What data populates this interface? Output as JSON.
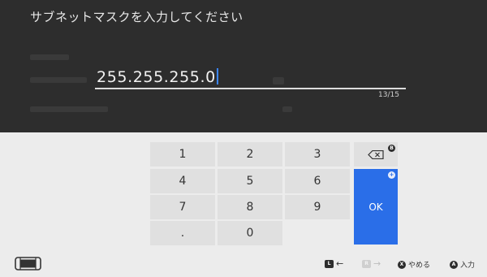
{
  "dialog": {
    "title": "サブネットマスクを入力してください"
  },
  "input": {
    "value": "255.255.255.0",
    "char_count": "13/15"
  },
  "keypad": {
    "keys": [
      "1",
      "2",
      "3",
      "4",
      "5",
      "6",
      "7",
      "8",
      "9",
      ".",
      "0"
    ],
    "backspace_badge": "B",
    "ok_label": "OK",
    "ok_badge": "+"
  },
  "footer": {
    "left_button": "L",
    "left_arrow": "←",
    "right_button": "R",
    "right_arrow": "→",
    "cancel_button": "X",
    "cancel_label": "やめる",
    "confirm_button": "A",
    "confirm_label": "入力"
  },
  "colors": {
    "accent": "#2a6ee8",
    "caret": "#3b86ff",
    "top_bg": "#2d2d2d",
    "keyboard_bg": "#ececec",
    "key_bg": "#e0e0e0"
  }
}
